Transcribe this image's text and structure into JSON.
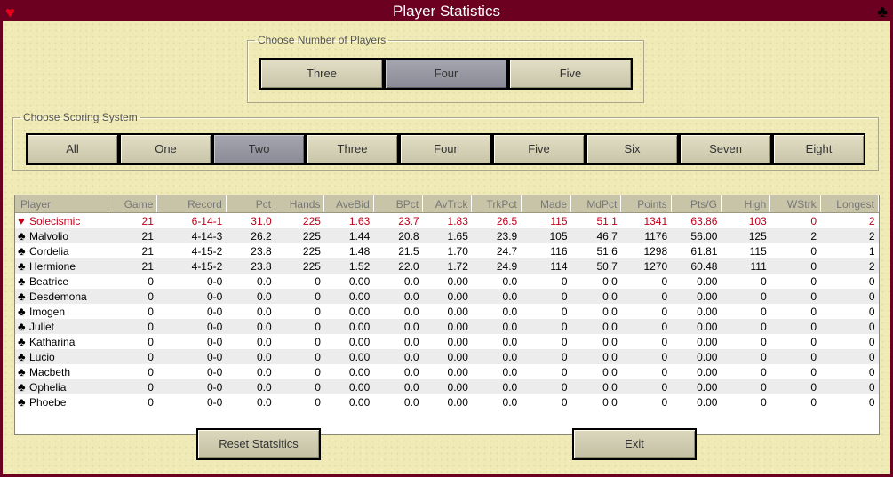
{
  "window": {
    "title": "Player Statistics",
    "left_icon": "heart-icon",
    "right_icon": "club-icon"
  },
  "players_group": {
    "legend": "Choose Number of Players",
    "options": [
      "Three",
      "Four",
      "Five"
    ],
    "selected": "Four"
  },
  "scoring_group": {
    "legend": "Choose Scoring System",
    "options": [
      "All",
      "One",
      "Two",
      "Three",
      "Four",
      "Five",
      "Six",
      "Seven",
      "Eight"
    ],
    "selected": "Two"
  },
  "table": {
    "columns": [
      "Player",
      "Game",
      "Record",
      "Pct",
      "Hands",
      "AveBid",
      "BPct",
      "AvTrck",
      "TrkPct",
      "Made",
      "MdPct",
      "Points",
      "Pts/G",
      "High",
      "WStrk",
      "Longest"
    ],
    "rows": [
      {
        "suit": "heart",
        "cells": [
          "Solecismic",
          "21",
          "6-14-1",
          "31.0",
          "225",
          "1.63",
          "23.7",
          "1.83",
          "26.5",
          "115",
          "51.1",
          "1341",
          "63.86",
          "103",
          "0",
          "2"
        ]
      },
      {
        "suit": "club",
        "cells": [
          "Malvolio",
          "21",
          "4-14-3",
          "26.2",
          "225",
          "1.44",
          "20.8",
          "1.65",
          "23.9",
          "105",
          "46.7",
          "1176",
          "56.00",
          "125",
          "2",
          "2"
        ]
      },
      {
        "suit": "club",
        "cells": [
          "Cordelia",
          "21",
          "4-15-2",
          "23.8",
          "225",
          "1.48",
          "21.5",
          "1.70",
          "24.7",
          "116",
          "51.6",
          "1298",
          "61.81",
          "115",
          "0",
          "1"
        ]
      },
      {
        "suit": "club",
        "cells": [
          "Hermione",
          "21",
          "4-15-2",
          "23.8",
          "225",
          "1.52",
          "22.0",
          "1.72",
          "24.9",
          "114",
          "50.7",
          "1270",
          "60.48",
          "111",
          "0",
          "2"
        ]
      },
      {
        "suit": "club",
        "cells": [
          "Beatrice",
          "0",
          "0-0",
          "0.0",
          "0",
          "0.00",
          "0.0",
          "0.00",
          "0.0",
          "0",
          "0.0",
          "0",
          "0.00",
          "0",
          "0",
          "0"
        ]
      },
      {
        "suit": "club",
        "cells": [
          "Desdemona",
          "0",
          "0-0",
          "0.0",
          "0",
          "0.00",
          "0.0",
          "0.00",
          "0.0",
          "0",
          "0.0",
          "0",
          "0.00",
          "0",
          "0",
          "0"
        ]
      },
      {
        "suit": "club",
        "cells": [
          "Imogen",
          "0",
          "0-0",
          "0.0",
          "0",
          "0.00",
          "0.0",
          "0.00",
          "0.0",
          "0",
          "0.0",
          "0",
          "0.00",
          "0",
          "0",
          "0"
        ]
      },
      {
        "suit": "club",
        "cells": [
          "Juliet",
          "0",
          "0-0",
          "0.0",
          "0",
          "0.00",
          "0.0",
          "0.00",
          "0.0",
          "0",
          "0.0",
          "0",
          "0.00",
          "0",
          "0",
          "0"
        ]
      },
      {
        "suit": "club",
        "cells": [
          "Katharina",
          "0",
          "0-0",
          "0.0",
          "0",
          "0.00",
          "0.0",
          "0.00",
          "0.0",
          "0",
          "0.0",
          "0",
          "0.00",
          "0",
          "0",
          "0"
        ]
      },
      {
        "suit": "club",
        "cells": [
          "Lucio",
          "0",
          "0-0",
          "0.0",
          "0",
          "0.00",
          "0.0",
          "0.00",
          "0.0",
          "0",
          "0.0",
          "0",
          "0.00",
          "0",
          "0",
          "0"
        ]
      },
      {
        "suit": "club",
        "cells": [
          "Macbeth",
          "0",
          "0-0",
          "0.0",
          "0",
          "0.00",
          "0.0",
          "0.00",
          "0.0",
          "0",
          "0.0",
          "0",
          "0.00",
          "0",
          "0",
          "0"
        ]
      },
      {
        "suit": "club",
        "cells": [
          "Ophelia",
          "0",
          "0-0",
          "0.0",
          "0",
          "0.00",
          "0.0",
          "0.00",
          "0.0",
          "0",
          "0.0",
          "0",
          "0.00",
          "0",
          "0",
          "0"
        ]
      },
      {
        "suit": "club",
        "cells": [
          "Phoebe",
          "0",
          "0-0",
          "0.0",
          "0",
          "0.00",
          "0.0",
          "0.00",
          "0.0",
          "0",
          "0.0",
          "0",
          "0.00",
          "0",
          "0",
          "0"
        ]
      }
    ]
  },
  "actions": {
    "reset_label": "Reset Statsitics",
    "exit_label": "Exit"
  },
  "colors": {
    "titlebar": "#6b0020",
    "background": "#efeab6",
    "highlight_player": "#c0001a",
    "selected_button": "#9a9aa4"
  }
}
